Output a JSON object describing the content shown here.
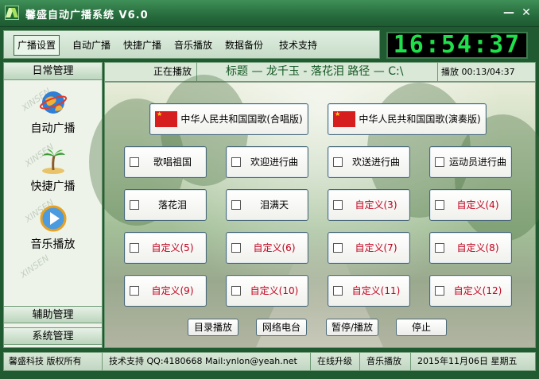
{
  "window": {
    "title": "馨盛自动广播系统 V6.0",
    "minimize": "—",
    "close": "✕"
  },
  "menu": {
    "items": [
      "广播设置",
      "自动广播",
      "快捷广播",
      "音乐播放",
      "数据备份",
      "技术支持"
    ],
    "active": "广播设置"
  },
  "clock": {
    "time": "16:54:37"
  },
  "sidebar": {
    "daily_header": "日常管理",
    "nav": [
      {
        "label": "自动广播",
        "icon": "globe-icon"
      },
      {
        "label": "快捷广播",
        "icon": "palm-tree-icon"
      },
      {
        "label": "音乐播放",
        "icon": "play-icon"
      }
    ],
    "aux_header": "辅助管理",
    "sys_header": "系统管理",
    "watermark": "XINSEN"
  },
  "status": {
    "now_playing_label": "正在播放",
    "ticker": "标题 — 龙千玉 - 落花泪    路径 — C:\\",
    "progress": "播放 00:13/04:37"
  },
  "anthems": [
    "中华人民共和国国歌(合唱版)",
    "中华人民共和国国歌(演奏版)"
  ],
  "songs": [
    "歌唱祖国",
    "欢迎进行曲",
    "欢送进行曲",
    "运动员进行曲",
    "落花泪",
    "泪满天",
    "自定义(3)",
    "自定义(4)",
    "自定义(5)",
    "自定义(6)",
    "自定义(7)",
    "自定义(8)",
    "自定义(9)",
    "自定义(10)",
    "自定义(11)",
    "自定义(12)"
  ],
  "controls": [
    "目录播放",
    "网络电台",
    "暂停/播放",
    "停止"
  ],
  "footer": {
    "company": "馨盛科技 版权所有",
    "support": "技术支持 QQ:4180668  Mail:ynlon@yeah.net",
    "upgrade": "在线升级",
    "music": "音乐播放",
    "date": "2015年11月06日 星期五"
  },
  "colors": {
    "accent": "#266b3c",
    "clock_digits": "#1fe04a",
    "custom_text": "#c0001c"
  }
}
